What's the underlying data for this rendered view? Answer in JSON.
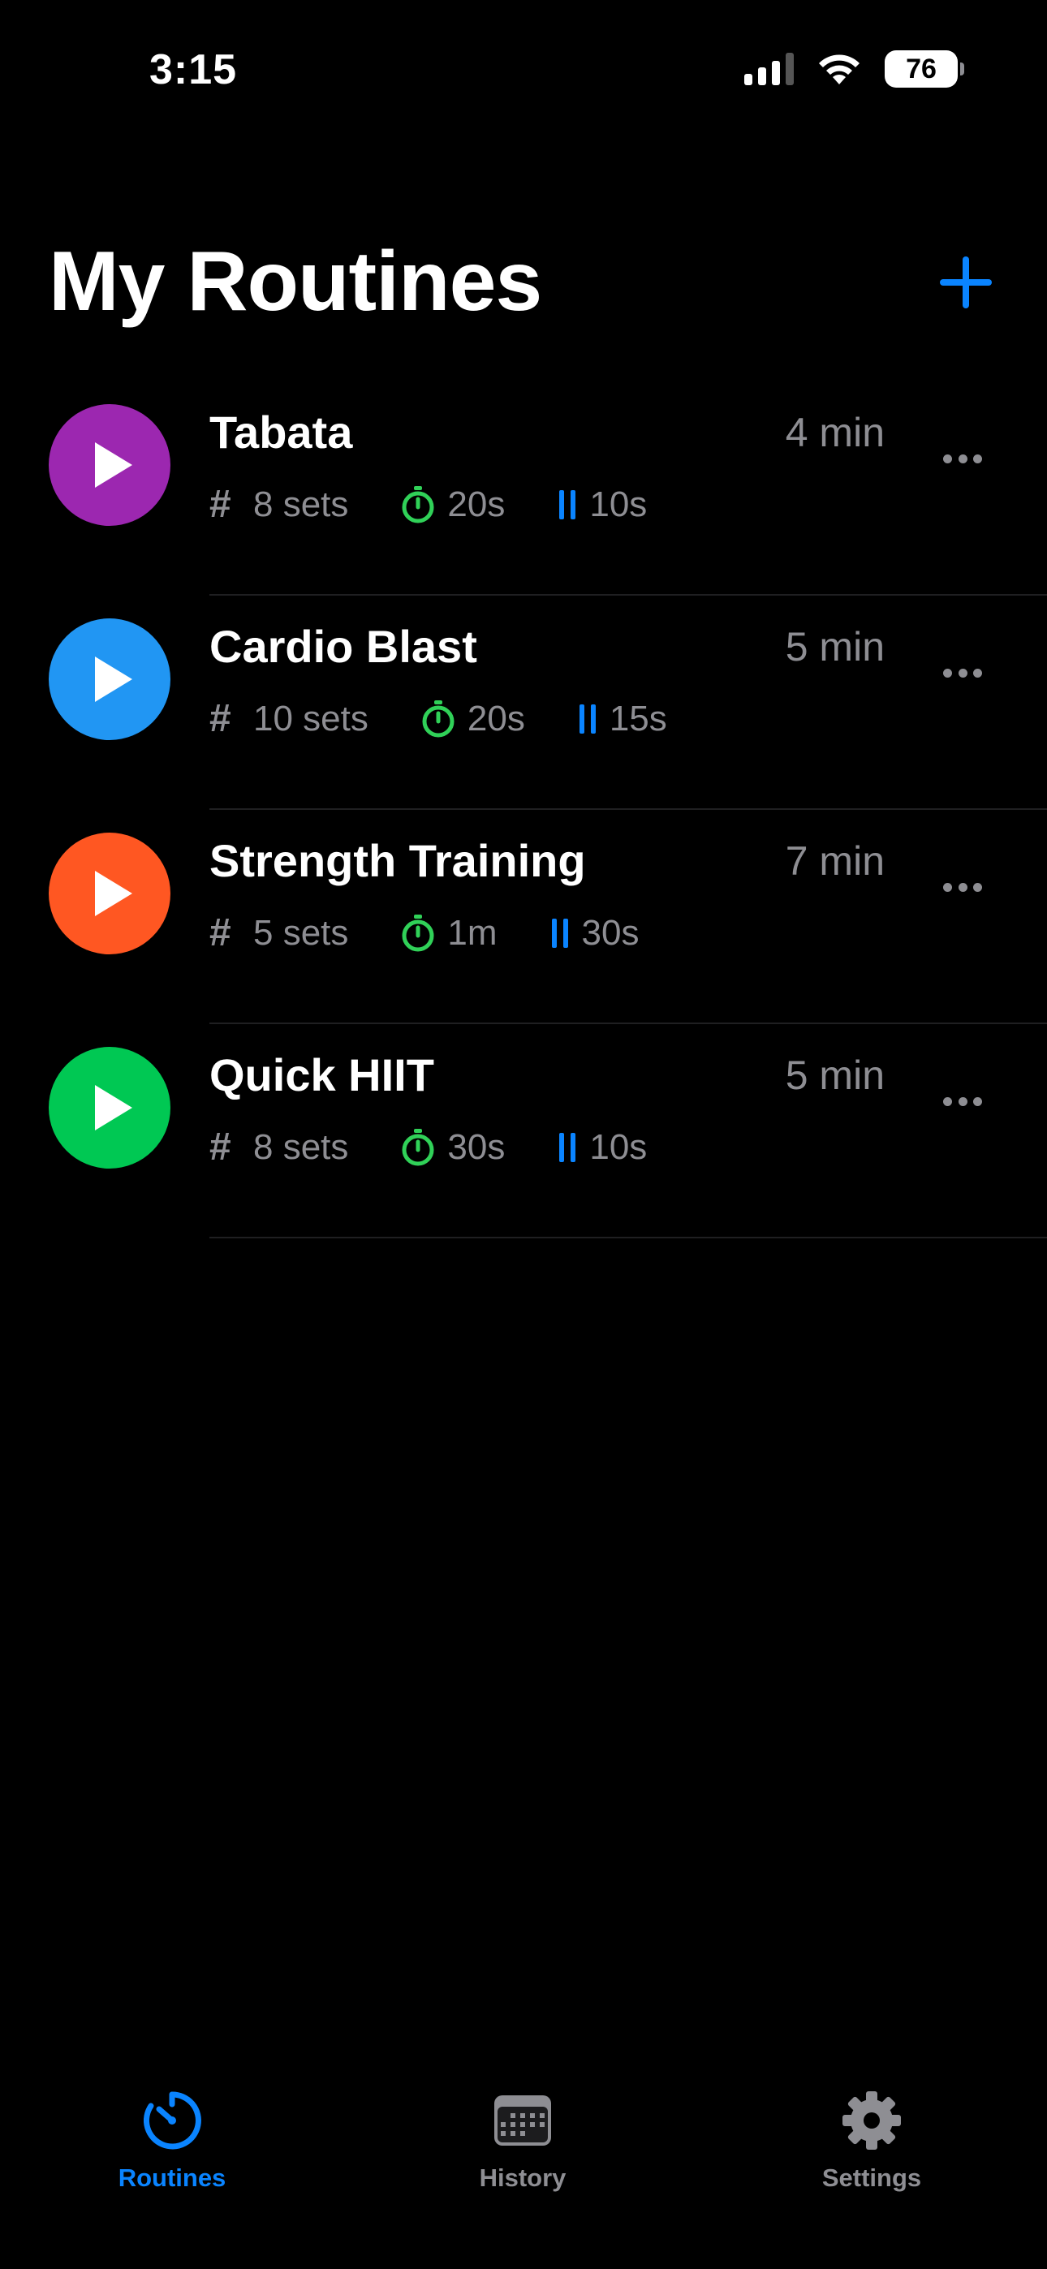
{
  "status_bar": {
    "time": "3:15",
    "battery": "76",
    "icons": [
      "cellular-signal-icon",
      "wifi-icon",
      "battery-icon"
    ]
  },
  "header": {
    "title": "My Routines",
    "add_icon": "plus-icon"
  },
  "colors": {
    "accent": "#0a84ff",
    "timer": "#30d158",
    "secondary_text": "#8e8e93",
    "background": "#000000"
  },
  "routines": [
    {
      "name": "Tabata",
      "duration": "4 min",
      "sets": "8 sets",
      "work": "20s",
      "rest": "10s",
      "color": "#9c27b0"
    },
    {
      "name": "Cardio Blast",
      "duration": "5 min",
      "sets": "10 sets",
      "work": "20s",
      "rest": "15s",
      "color": "#2196f3"
    },
    {
      "name": "Strength Training",
      "duration": "7 min",
      "sets": "5 sets",
      "work": "1m",
      "rest": "30s",
      "color": "#ff5722"
    },
    {
      "name": "Quick HIIT",
      "duration": "5 min",
      "sets": "8 sets",
      "work": "30s",
      "rest": "10s",
      "color": "#00c853"
    }
  ],
  "tabs": [
    {
      "label": "Routines",
      "icon": "timer-icon",
      "active": true
    },
    {
      "label": "History",
      "icon": "calendar-icon",
      "active": false
    },
    {
      "label": "Settings",
      "icon": "gear-icon",
      "active": false
    }
  ]
}
